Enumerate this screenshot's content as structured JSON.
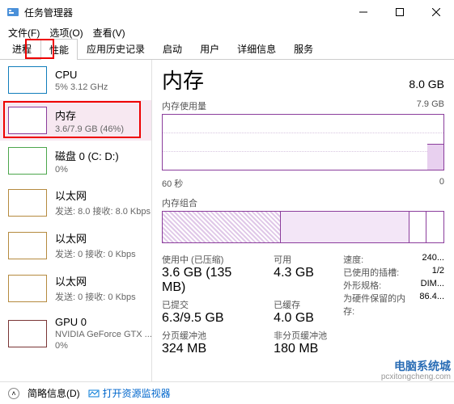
{
  "window": {
    "title": "任务管理器",
    "controls": {
      "min": "minimize",
      "max": "maximize",
      "close": "close"
    }
  },
  "menubar": {
    "file": "文件(F)",
    "options": "选项(O)",
    "view": "查看(V)"
  },
  "tabs": {
    "processes": "进程",
    "performance": "性能",
    "app_history": "应用历史记录",
    "startup": "启动",
    "users": "用户",
    "details": "详细信息",
    "services": "服务"
  },
  "sidebar": {
    "cpu": {
      "name": "CPU",
      "detail": "5% 3.12 GHz"
    },
    "memory": {
      "name": "内存",
      "detail": "3.6/7.9 GB (46%)"
    },
    "disk": {
      "name": "磁盘 0 (C: D:)",
      "detail": "0%"
    },
    "eth1": {
      "name": "以太网",
      "detail": "发送: 8.0 接收: 8.0 Kbps"
    },
    "eth2": {
      "name": "以太网",
      "detail": "发送: 0 接收: 0 Kbps"
    },
    "eth3": {
      "name": "以太网",
      "detail": "发送: 0 接收: 0 Kbps"
    },
    "gpu": {
      "name": "GPU 0",
      "detail1": "NVIDIA GeForce GTX ...",
      "detail2": "0%"
    }
  },
  "main": {
    "title": "内存",
    "total": "8.0 GB",
    "usage_label": "内存使用量",
    "usage_max": "7.9 GB",
    "x_label": "60 秒",
    "x_zero": "0",
    "compo_label": "内存组合",
    "stats": {
      "in_use_label": "使用中 (已压缩)",
      "in_use_value": "3.6 GB (135 MB)",
      "available_label": "可用",
      "available_value": "4.3 GB",
      "committed_label": "已提交",
      "committed_value": "6.3/9.5 GB",
      "cached_label": "已缓存",
      "cached_value": "4.0 GB",
      "paged_label": "分页缓冲池",
      "paged_value": "324 MB",
      "nonpaged_label": "非分页缓冲池",
      "nonpaged_value": "180 MB"
    },
    "right": {
      "speed_label": "速度:",
      "speed_value": "240...",
      "slots_label": "已使用的插槽:",
      "slots_value": "1/2",
      "form_label": "外形规格:",
      "form_value": "DIM...",
      "reserved_label": "为硬件保留的内存:",
      "reserved_value": "86.4..."
    }
  },
  "footer": {
    "simple": "简略信息(D)",
    "resmon": "打开资源监视器"
  },
  "watermark": {
    "line1": "电脑系统城",
    "line2": "pcxitongcheng.com"
  },
  "chart_data": {
    "type": "line",
    "title": "内存使用量",
    "ylabel": "GB",
    "ylim": [
      0,
      7.9
    ],
    "xrange_seconds": 60,
    "current_value_gb": 3.6,
    "note": "mostly empty timeline; recent spike near right edge to ~3.6 GB"
  }
}
